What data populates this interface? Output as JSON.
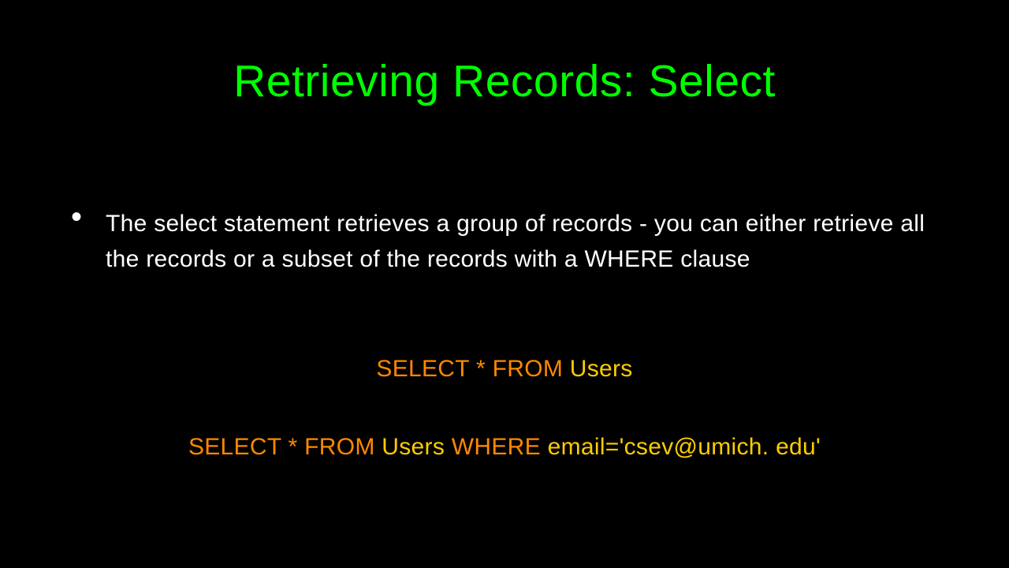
{
  "slide": {
    "title": "Retrieving Records: Select",
    "bullet_text": "The select statement retrieves a group of records - you can either retrieve all the records or a subset of the records with a WHERE clause",
    "code1": {
      "keyword1": "SELECT * FROM ",
      "table": "Users"
    },
    "code2": {
      "keyword1": "SELECT * FROM ",
      "table": "Users ",
      "keyword2": "WHERE ",
      "condition": "email='csev@umich. edu'"
    }
  }
}
